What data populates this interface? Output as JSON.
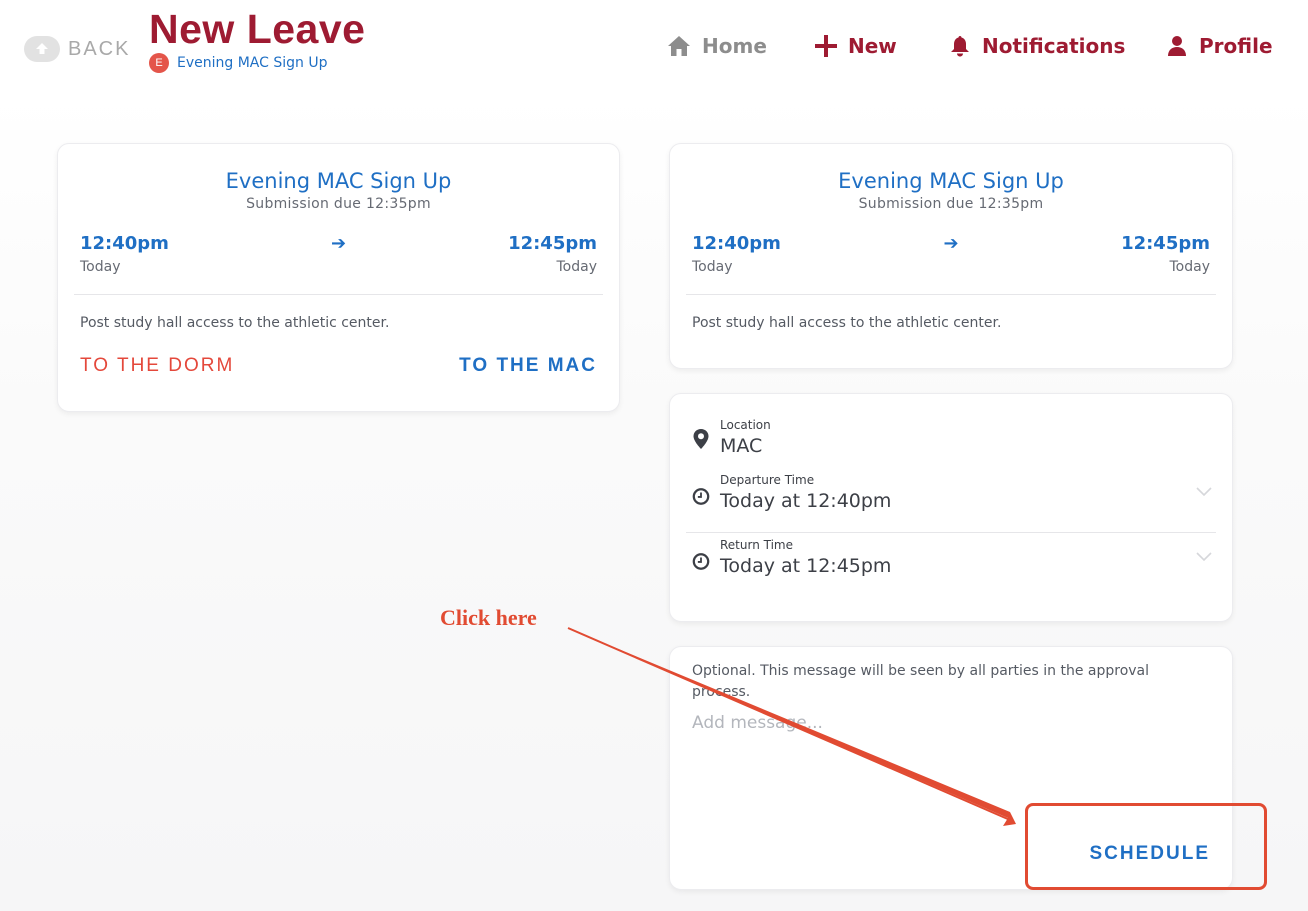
{
  "header": {
    "back_label": "BACK",
    "title": "New Leave",
    "subtitle_badge": "E",
    "subtitle": "Evening MAC Sign Up",
    "nav": {
      "home": "Home",
      "new": "New",
      "notifications": "Notifications",
      "profile": "Profile"
    }
  },
  "leave_card": {
    "title": "Evening MAC Sign Up",
    "submission": "Submission due 12:35pm",
    "start_time": "12:40pm",
    "start_day": "Today",
    "end_time": "12:45pm",
    "end_day": "Today",
    "description": "Post study hall access to the athletic center.",
    "action_dorm": "TO THE DORM",
    "action_mac": "TO THE MAC"
  },
  "summary_card": {
    "title": "Evening MAC Sign Up",
    "submission": "Submission due 12:35pm",
    "start_time": "12:40pm",
    "start_day": "Today",
    "end_time": "12:45pm",
    "end_day": "Today",
    "description": "Post study hall access to the athletic center."
  },
  "details": {
    "location_label": "Location",
    "location_value": "MAC",
    "departure_label": "Departure Time",
    "departure_value": "Today at 12:40pm",
    "return_label": "Return Time",
    "return_value": "Today at 12:45pm"
  },
  "message": {
    "hint": "Optional. This message will be seen by all parties in the approval process.",
    "placeholder": "Add message...",
    "value": "",
    "schedule_label": "SCHEDULE"
  },
  "annotation": {
    "text": "Click here"
  },
  "colors": {
    "brand_red": "#9e1b32",
    "accent_blue": "#1f6fc4",
    "alert_red": "#e4483b"
  }
}
